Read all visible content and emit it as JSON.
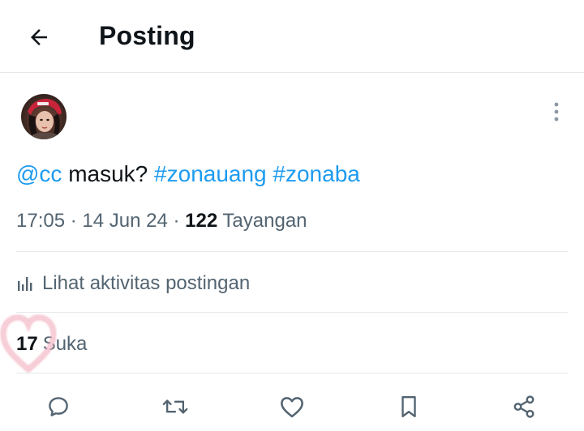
{
  "header": {
    "title": "Posting",
    "back_icon": "arrow-left-icon"
  },
  "author": {
    "avatar_icon": "avatar",
    "more_icon": "more-vertical-icon"
  },
  "tweet": {
    "mention": "@cc",
    "body": " masuk? ",
    "hashtag1": "#zonauang",
    "hashtag2": "#zonaba",
    "link_color": "#1d9bf0"
  },
  "meta": {
    "time": "17:05",
    "sep1": " · ",
    "date": "14 Jun 24",
    "sep2": " · ",
    "views_count": "122",
    "views_label": " Tayangan"
  },
  "activity": {
    "label": "Lihat aktivitas postingan",
    "icon": "analytics-icon"
  },
  "likes": {
    "count": "17",
    "label": "Suka"
  },
  "actions": [
    {
      "name": "reply",
      "icon": "reply-icon"
    },
    {
      "name": "repost",
      "icon": "repost-icon"
    },
    {
      "name": "like",
      "icon": "heart-icon"
    },
    {
      "name": "bookmark",
      "icon": "bookmark-icon"
    },
    {
      "name": "share",
      "icon": "share-icon"
    }
  ],
  "colors": {
    "text": "#0f1419",
    "secondary": "#536471",
    "divider": "#e6e8ea",
    "accent": "#1d9bf0"
  }
}
